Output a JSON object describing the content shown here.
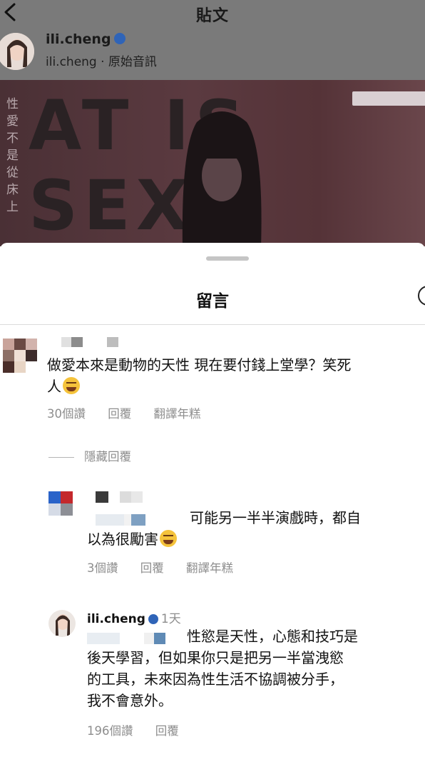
{
  "header": {
    "title": "貼文"
  },
  "post": {
    "username": "ili.cheng",
    "subtitle": "ili.cheng · 原始音訊",
    "media_text": "AT IS SEX!",
    "vertical_caption": "性愛不是從床上"
  },
  "sheet": {
    "title": "留言"
  },
  "comments": [
    {
      "text_line1": "做愛本來是動物的天性 現在要付錢上堂學？笑死",
      "text_line2": "人",
      "emoji": "laughing-with-tears-emoji",
      "likes": "30個讚",
      "reply": "回覆",
      "translate": "翻譯年糕"
    }
  ],
  "hidden_replies": "隱藏回覆",
  "replies": [
    {
      "text_line1": "可能另一半半演戲時，都自",
      "text_line2": "以為很勵害",
      "emoji": "sweat-smile-emoji",
      "likes": "3個讚",
      "reply": "回覆",
      "translate": "翻譯年糕"
    },
    {
      "username": "ili.cheng",
      "time": "1天",
      "text_line1": "性慾是天性，心態和技巧是",
      "text_line2": "後天學習，但如果你只是把另一半當洩慾",
      "text_line3": "的工具，未來因為性生活不協調被分手，",
      "text_line4": "我不會意外。",
      "likes": "196個讚",
      "reply": "回覆"
    }
  ],
  "colors": {
    "overlay": "#7a7a7a",
    "secondary_text": "#8e8e8e",
    "verified": "#2f64b8"
  }
}
